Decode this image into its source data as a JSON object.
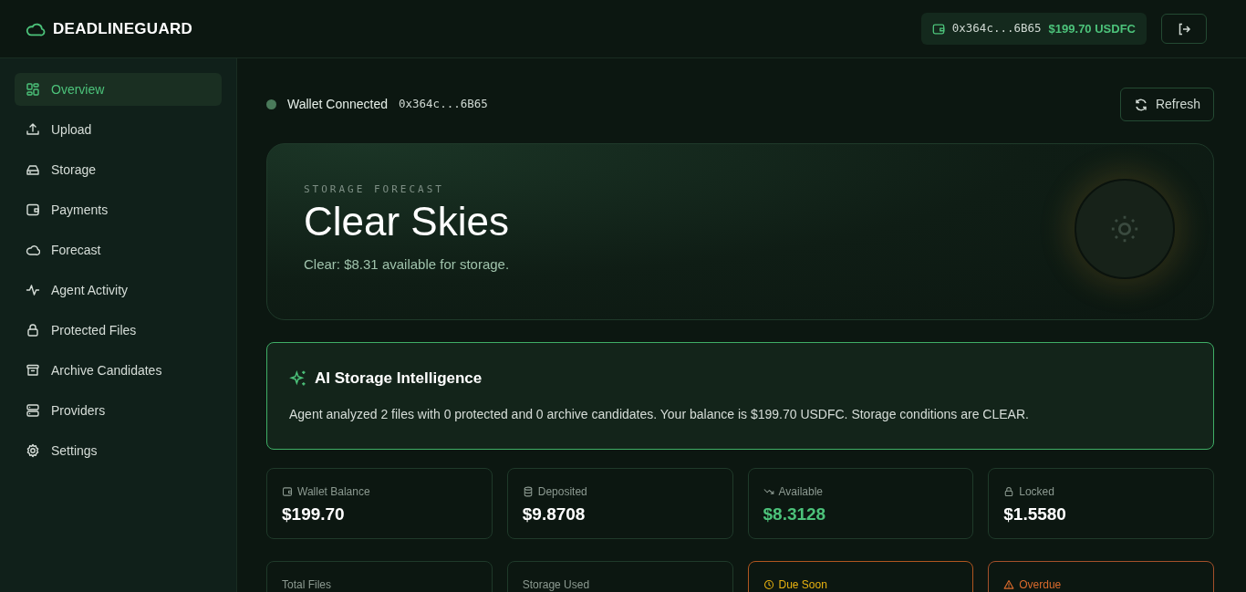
{
  "brand": "DEADLINEGUARD",
  "header": {
    "address": "0x364c...6B65",
    "balance": "$199.70 USDFC"
  },
  "sidebar": {
    "items": [
      {
        "label": "Overview",
        "selected": true
      },
      {
        "label": "Upload",
        "selected": false
      },
      {
        "label": "Storage",
        "selected": false
      },
      {
        "label": "Payments",
        "selected": false
      },
      {
        "label": "Forecast",
        "selected": false
      },
      {
        "label": "Agent Activity",
        "selected": false
      },
      {
        "label": "Protected Files",
        "selected": false
      },
      {
        "label": "Archive Candidates",
        "selected": false
      },
      {
        "label": "Providers",
        "selected": false
      },
      {
        "label": "Settings",
        "selected": false
      }
    ]
  },
  "status": {
    "label": "Wallet Connected",
    "address": "0x364c...6B65",
    "connected": true
  },
  "refresh_button": "Refresh",
  "forecast": {
    "eyebrow": "STORAGE FORECAST",
    "title": "Clear Skies",
    "message": "Clear: $8.31 available for storage."
  },
  "ai_panel": {
    "title": "AI Storage Intelligence",
    "text": "Agent analyzed 2 files with 0 protected and 0 archive candidates. Your balance is $199.70 USDFC. Storage conditions are CLEAR."
  },
  "stats": [
    {
      "label": "Wallet Balance",
      "value": "$199.70",
      "kind": "default"
    },
    {
      "label": "Deposited",
      "value": "$9.8708",
      "kind": "default"
    },
    {
      "label": "Available",
      "value": "$8.3128",
      "kind": "positive"
    },
    {
      "label": "Locked",
      "value": "$1.5580",
      "kind": "default"
    }
  ],
  "status_cards": [
    {
      "label": "Total Files",
      "kind": "default"
    },
    {
      "label": "Storage Used",
      "kind": "default"
    },
    {
      "label": "Due Soon",
      "kind": "warning"
    },
    {
      "label": "Overdue",
      "kind": "danger"
    }
  ]
}
